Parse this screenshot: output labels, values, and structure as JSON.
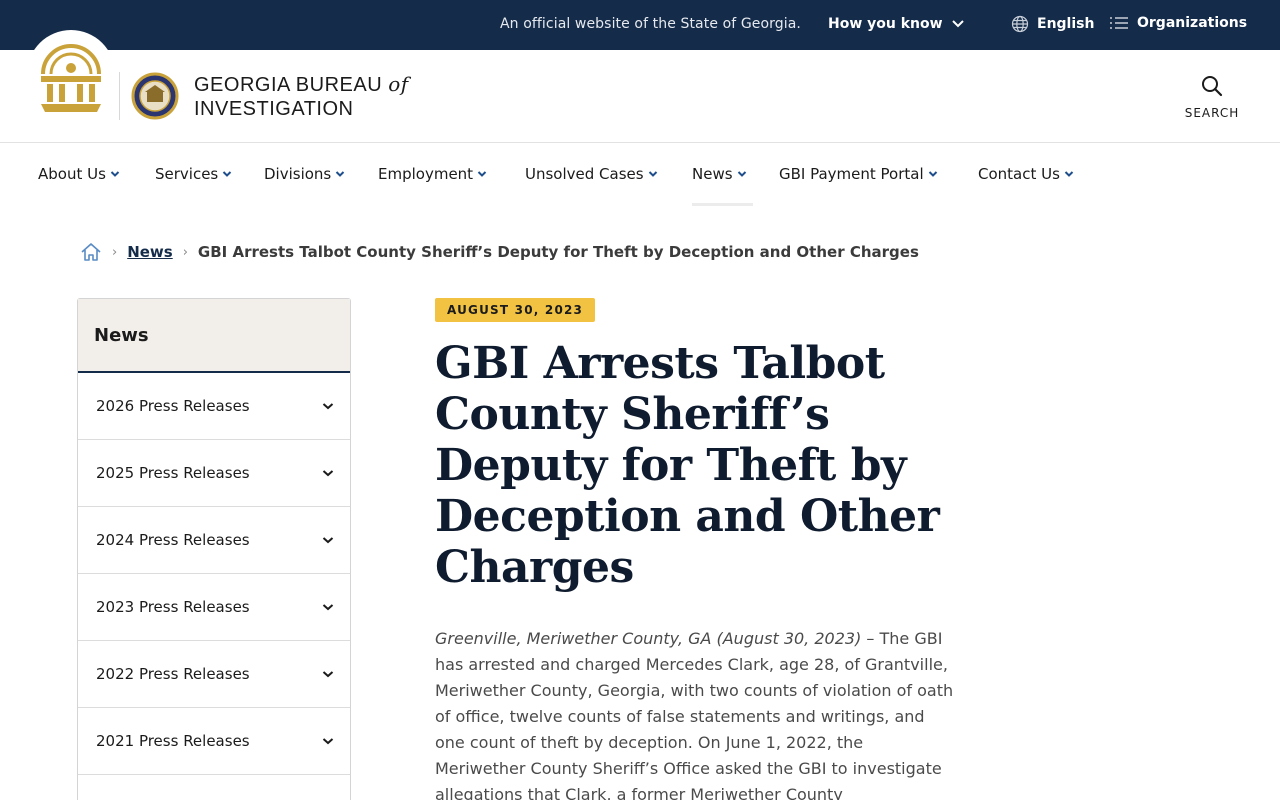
{
  "topbar": {
    "official_text": "An official website of the State of Georgia.",
    "how_you_know": "How you know",
    "language": "English",
    "organizations": "Organizations"
  },
  "header": {
    "title_line1": "GEORGIA BUREAU",
    "title_of": "of",
    "title_line2": "INVESTIGATION",
    "search_label": "SEARCH"
  },
  "nav": {
    "items": [
      {
        "label": "About Us"
      },
      {
        "label": "Services"
      },
      {
        "label": "Divisions"
      },
      {
        "label": "Employment"
      },
      {
        "label": "Unsolved Cases"
      },
      {
        "label": "News"
      },
      {
        "label": "GBI Payment Portal"
      },
      {
        "label": "Contact Us"
      }
    ],
    "active": "News"
  },
  "breadcrumb": {
    "link": "News",
    "current": "GBI Arrests Talbot County Sheriff’s Deputy for Theft by Deception and Other Charges"
  },
  "sidebar": {
    "heading": "News",
    "items": [
      {
        "label": "2026 Press Releases"
      },
      {
        "label": "2025 Press Releases"
      },
      {
        "label": "2024 Press Releases"
      },
      {
        "label": "2023 Press Releases"
      },
      {
        "label": "2022 Press Releases"
      },
      {
        "label": "2021 Press Releases"
      }
    ]
  },
  "article": {
    "date": "AUGUST 30, 2023",
    "headline": "GBI Arrests Talbot County Sheriff’s Deputy for Theft by Deception and Other Charges",
    "location": "Greenville, Meriwether County, GA (August 30, 2023)",
    "body": " – The GBI has arrested and charged Mercedes Clark, age 28, of Grantville, Meriwether County, Georgia, with two counts of violation of oath of office, twelve counts of false statements and writings, and one count of theft by deception. On June 1, 2022, the Meriwether County Sheriff’s Office asked the GBI to investigate allegations that Clark, a former Meriwether County"
  },
  "colors": {
    "navy": "#142b4a",
    "gold": "#f2c343",
    "seal_gold": "#c9a23a"
  }
}
